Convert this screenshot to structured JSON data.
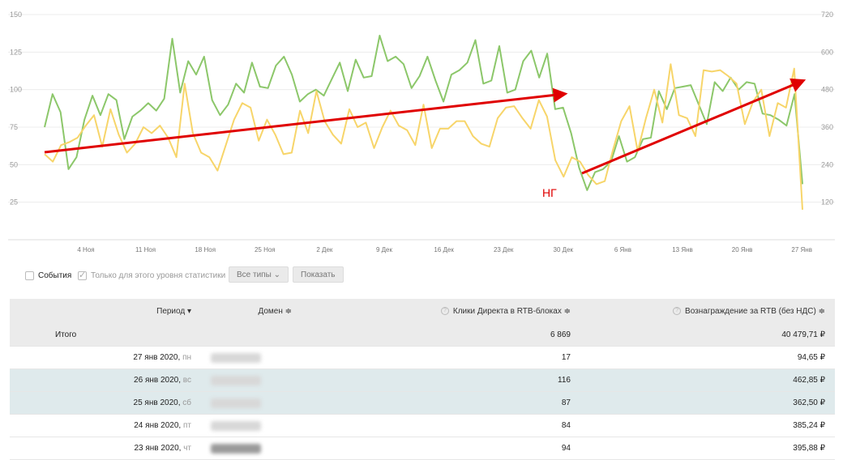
{
  "chart_data": {
    "type": "line",
    "y_left_ticks": [
      "150",
      "125",
      "100",
      "75",
      "50",
      "25"
    ],
    "y_right_ticks": [
      "720",
      "600",
      "480",
      "360",
      "240",
      "120"
    ],
    "x_ticks": [
      "4 Ноя",
      "11 Ноя",
      "18 Ноя",
      "25 Ноя",
      "2 Дек",
      "9 Дек",
      "16 Дек",
      "23 Дек",
      "30 Дек",
      "6 Янв",
      "13 Янв",
      "20 Янв",
      "27 Янв"
    ],
    "ylim_left": [
      0,
      150
    ],
    "ylim_right": [
      0,
      720
    ],
    "colors": {
      "clicks": "#8cc76a",
      "reward": "#f7d56a",
      "arrow": "#e00000"
    },
    "series": [
      {
        "values": [
          75,
          97,
          85,
          47,
          55,
          80,
          96,
          83,
          97,
          93,
          67,
          82,
          86,
          91,
          86,
          94,
          134,
          98,
          119,
          110,
          122,
          93,
          83,
          90,
          104,
          98,
          118,
          102,
          101,
          116,
          122,
          110,
          92,
          97,
          100,
          96,
          107,
          118,
          99,
          120,
          108,
          109,
          136,
          119,
          122,
          117,
          101,
          109,
          122,
          106,
          92,
          110,
          113,
          118,
          133,
          104,
          106,
          129,
          98,
          100,
          119,
          126,
          108,
          124,
          87,
          88,
          71,
          48,
          33,
          45,
          47,
          52,
          69,
          52,
          55,
          67,
          68,
          99,
          87,
          101,
          102,
          103,
          90,
          77,
          105,
          99,
          108,
          100,
          105,
          104,
          84,
          83,
          80,
          76,
          97,
          37
        ]
      },
      {
        "values": [
          57,
          52,
          63,
          65,
          68,
          76,
          83,
          62,
          87,
          70,
          58,
          64,
          75,
          71,
          76,
          68,
          55,
          104,
          71,
          58,
          55,
          46,
          63,
          80,
          91,
          88,
          66,
          80,
          70,
          57,
          58,
          86,
          71,
          99,
          79,
          70,
          64,
          87,
          75,
          78,
          61,
          75,
          86,
          76,
          73,
          63,
          90,
          61,
          74,
          74,
          79,
          79,
          69,
          64,
          62,
          81,
          88,
          89,
          81,
          74,
          93,
          82,
          53,
          42,
          55,
          52,
          43,
          37,
          39,
          60,
          79,
          89,
          59,
          81,
          100,
          78,
          117,
          83,
          81,
          69,
          113,
          112,
          113,
          109,
          104,
          77,
          92,
          100,
          69,
          91,
          88,
          114,
          20
        ]
      }
    ]
  },
  "annotation": "НГ",
  "controls": {
    "events_label": "События",
    "only_level_label": "Только для этого уровня статистики",
    "types_button": "Все типы",
    "show_button": "Показать"
  },
  "table": {
    "headers": {
      "period": "Период ▾",
      "domain": "Домен ≑",
      "clicks": "Клики Директа в RTB-блоках ≑",
      "reward": "Вознаграждение за RTB (без НДС) ≑"
    },
    "total": {
      "label": "Итого",
      "clicks": "6 869",
      "reward": "40 479,71 ₽"
    },
    "rows": [
      {
        "date": "27 янв 2020,",
        "dow": "пн",
        "clicks": "17",
        "reward": "94,65 ₽"
      },
      {
        "date": "26 янв 2020,",
        "dow": "вс",
        "clicks": "116",
        "reward": "462,85 ₽"
      },
      {
        "date": "25 янв 2020,",
        "dow": "сб",
        "clicks": "87",
        "reward": "362,50 ₽"
      },
      {
        "date": "24 янв 2020,",
        "dow": "пт",
        "clicks": "84",
        "reward": "385,24 ₽"
      },
      {
        "date": "23 янв 2020,",
        "dow": "чт",
        "clicks": "94",
        "reward": "395,88 ₽"
      }
    ]
  }
}
